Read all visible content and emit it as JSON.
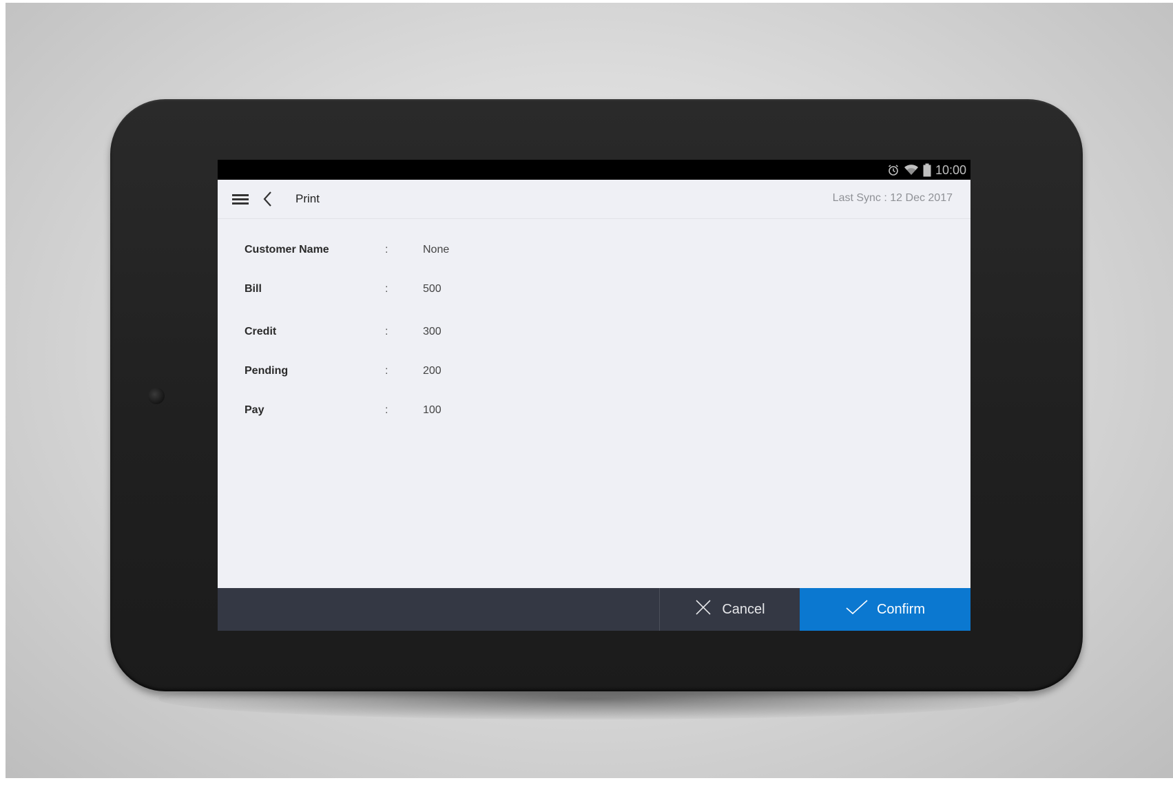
{
  "status_bar": {
    "time": "10:00",
    "icons": [
      "alarm-icon",
      "wifi-icon",
      "battery-icon"
    ]
  },
  "app_bar": {
    "menu_icon": "hamburger-menu-icon",
    "back_icon": "chevron-left-icon",
    "title": "Print",
    "last_sync": "Last Sync :  12 Dec 2017"
  },
  "details": {
    "separator": ":",
    "rows": [
      {
        "label": "Customer Name",
        "value": "None"
      },
      {
        "label": "Bill",
        "value": "500"
      },
      {
        "label": "Credit",
        "value": "300"
      },
      {
        "label": "Pending",
        "value": "200"
      },
      {
        "label": "Pay",
        "value": "100"
      }
    ]
  },
  "actions": {
    "cancel_label": "Cancel",
    "cancel_icon": "close-icon",
    "confirm_label": "Confirm",
    "confirm_icon": "check-icon"
  },
  "colors": {
    "accent": "#0b78d0",
    "bottom_bar": "#343844",
    "screen_bg": "#eff0f5"
  }
}
